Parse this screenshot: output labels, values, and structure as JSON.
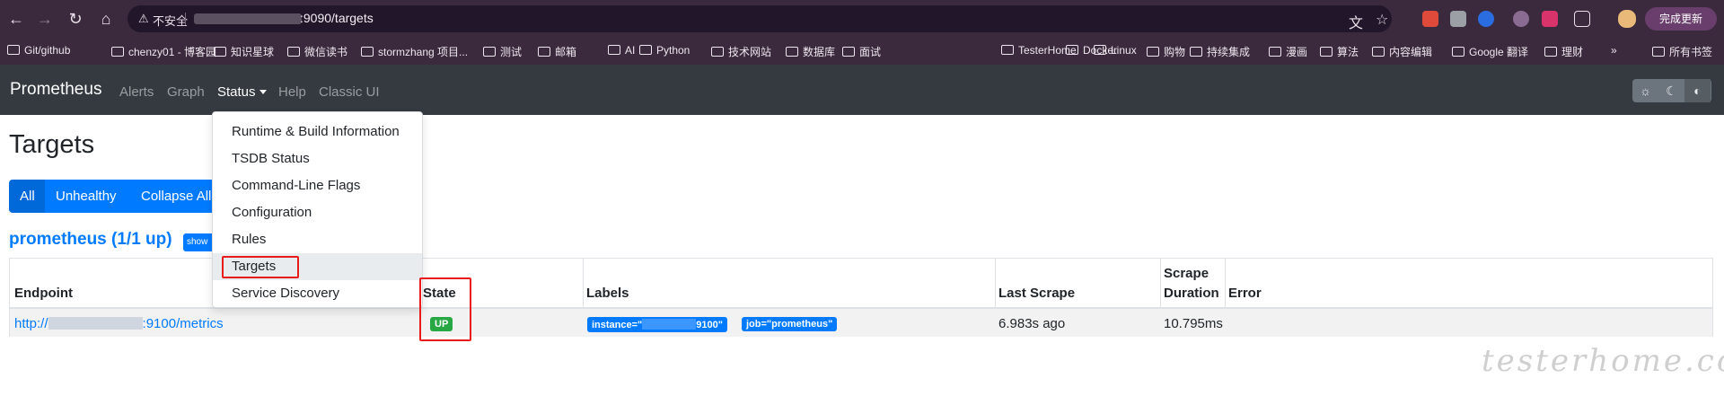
{
  "browser": {
    "security_warning": "不安全",
    "url_suffix": ":9090/targets",
    "update_button": "完成更新",
    "bookmarks": [
      {
        "label": "Git/github"
      },
      {
        "label": "chenzy01 - 博客园"
      },
      {
        "label": "知识星球"
      },
      {
        "label": "微信读书"
      },
      {
        "label": "stormzhang 项目..."
      },
      {
        "label": "测试"
      },
      {
        "label": "邮箱"
      },
      {
        "label": "AI"
      },
      {
        "label": "Python"
      },
      {
        "label": "技术网站"
      },
      {
        "label": "数据库"
      },
      {
        "label": "面试"
      },
      {
        "label": "TesterHome"
      },
      {
        "label": "Docker"
      },
      {
        "label": "Linux"
      },
      {
        "label": "购物"
      },
      {
        "label": "持续集成"
      },
      {
        "label": "漫画"
      },
      {
        "label": "算法"
      },
      {
        "label": "内容编辑"
      },
      {
        "label": "Google 翻译"
      },
      {
        "label": "理财"
      }
    ],
    "bookmarks_overflow": "»",
    "all_bookmarks": "所有书签"
  },
  "navbar": {
    "brand": "Prometheus",
    "links": [
      "Alerts",
      "Graph",
      "Status",
      "Help",
      "Classic UI"
    ]
  },
  "status_menu": {
    "items": [
      "Runtime & Build Information",
      "TSDB Status",
      "Command-Line Flags",
      "Configuration",
      "Rules",
      "Targets",
      "Service Discovery"
    ]
  },
  "page": {
    "title": "Targets",
    "filters": [
      "All",
      "Unhealthy",
      "Collapse All"
    ],
    "job_title": "prometheus (1/1 up)",
    "show_less": "show less"
  },
  "table": {
    "headers": {
      "endpoint": "Endpoint",
      "state": "State",
      "labels": "Labels",
      "last_scrape": "Last Scrape",
      "scrape_duration_line1": "Scrape",
      "scrape_duration_line2": "Duration",
      "error": "Error"
    },
    "rows": [
      {
        "endpoint_prefix": "http://",
        "endpoint_suffix": ":9100/metrics",
        "state": "UP",
        "label_instance_prefix": "instance=\"",
        "label_instance_suffix": "9100\"",
        "label_job": "job=\"prometheus\"",
        "last_scrape": "6.983s ago",
        "scrape_duration": "10.795ms",
        "error": ""
      }
    ]
  },
  "watermark": "testerhome.com",
  "colors": {
    "chrome_bg": "#3b2a3d",
    "navbar_bg": "#343a40",
    "primary": "#007bff",
    "success": "#28a745",
    "highlight": "#e81b1b"
  }
}
